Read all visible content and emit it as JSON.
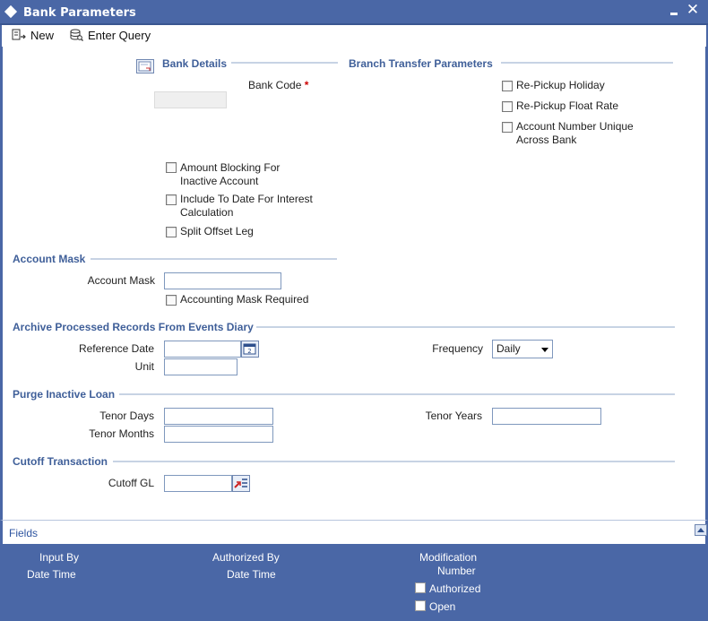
{
  "window": {
    "title": "Bank Parameters",
    "minimize_label": "",
    "close_label": "✕"
  },
  "toolbar": {
    "new_label": "New",
    "enter_query_label": "Enter Query"
  },
  "bank_details": {
    "title": "Bank Details",
    "bank_code_label": "Bank Code",
    "bank_code_required": "*",
    "bank_code_value": ""
  },
  "branch_transfer": {
    "title": "Branch Transfer Parameters",
    "checkboxes": [
      {
        "label": "Re-Pickup Holiday",
        "checked": false
      },
      {
        "label": "Re-Pickup Float Rate",
        "checked": false
      },
      {
        "label": "Account Number Unique Across Bank",
        "checked": false
      }
    ]
  },
  "bank_options": {
    "checkboxes": [
      {
        "label": "Amount Blocking For Inactive Account",
        "checked": false
      },
      {
        "label": "Include To Date For Interest Calculation",
        "checked": false
      },
      {
        "label": "Split Offset Leg",
        "checked": false
      }
    ]
  },
  "account_mask": {
    "title": "Account Mask",
    "field_label": "Account Mask",
    "field_value": "",
    "accounting_mask_required_label": "Accounting Mask Required",
    "accounting_mask_required_checked": false
  },
  "archive": {
    "title": "Archive Processed Records From Events Diary",
    "reference_date_label": "Reference Date",
    "reference_date_value": "",
    "unit_label": "Unit",
    "unit_value": "",
    "frequency_label": "Frequency",
    "frequency_selected": "Daily"
  },
  "purge": {
    "title": "Purge Inactive Loan",
    "tenor_days_label": "Tenor Days",
    "tenor_months_label": "Tenor Months",
    "tenor_years_label": "Tenor Years",
    "tenor_days_value": "",
    "tenor_months_value": "",
    "tenor_years_value": ""
  },
  "cutoff": {
    "title": "Cutoff Transaction",
    "cutoff_gl_label": "Cutoff GL",
    "cutoff_gl_value": ""
  },
  "footer": {
    "fields_label": "Fields",
    "input_by_label": "Input By",
    "date_time_label_1": "Date Time",
    "authorized_by_label": "Authorized By",
    "date_time_label_2": "Date Time",
    "modification_label": "Modification",
    "number_label": "Number",
    "authorized_label": "Authorized",
    "open_label": "Open"
  },
  "colors": {
    "header_blue": "#4a67a6",
    "section_title": "#3f5f99",
    "required": "#cc0000"
  }
}
